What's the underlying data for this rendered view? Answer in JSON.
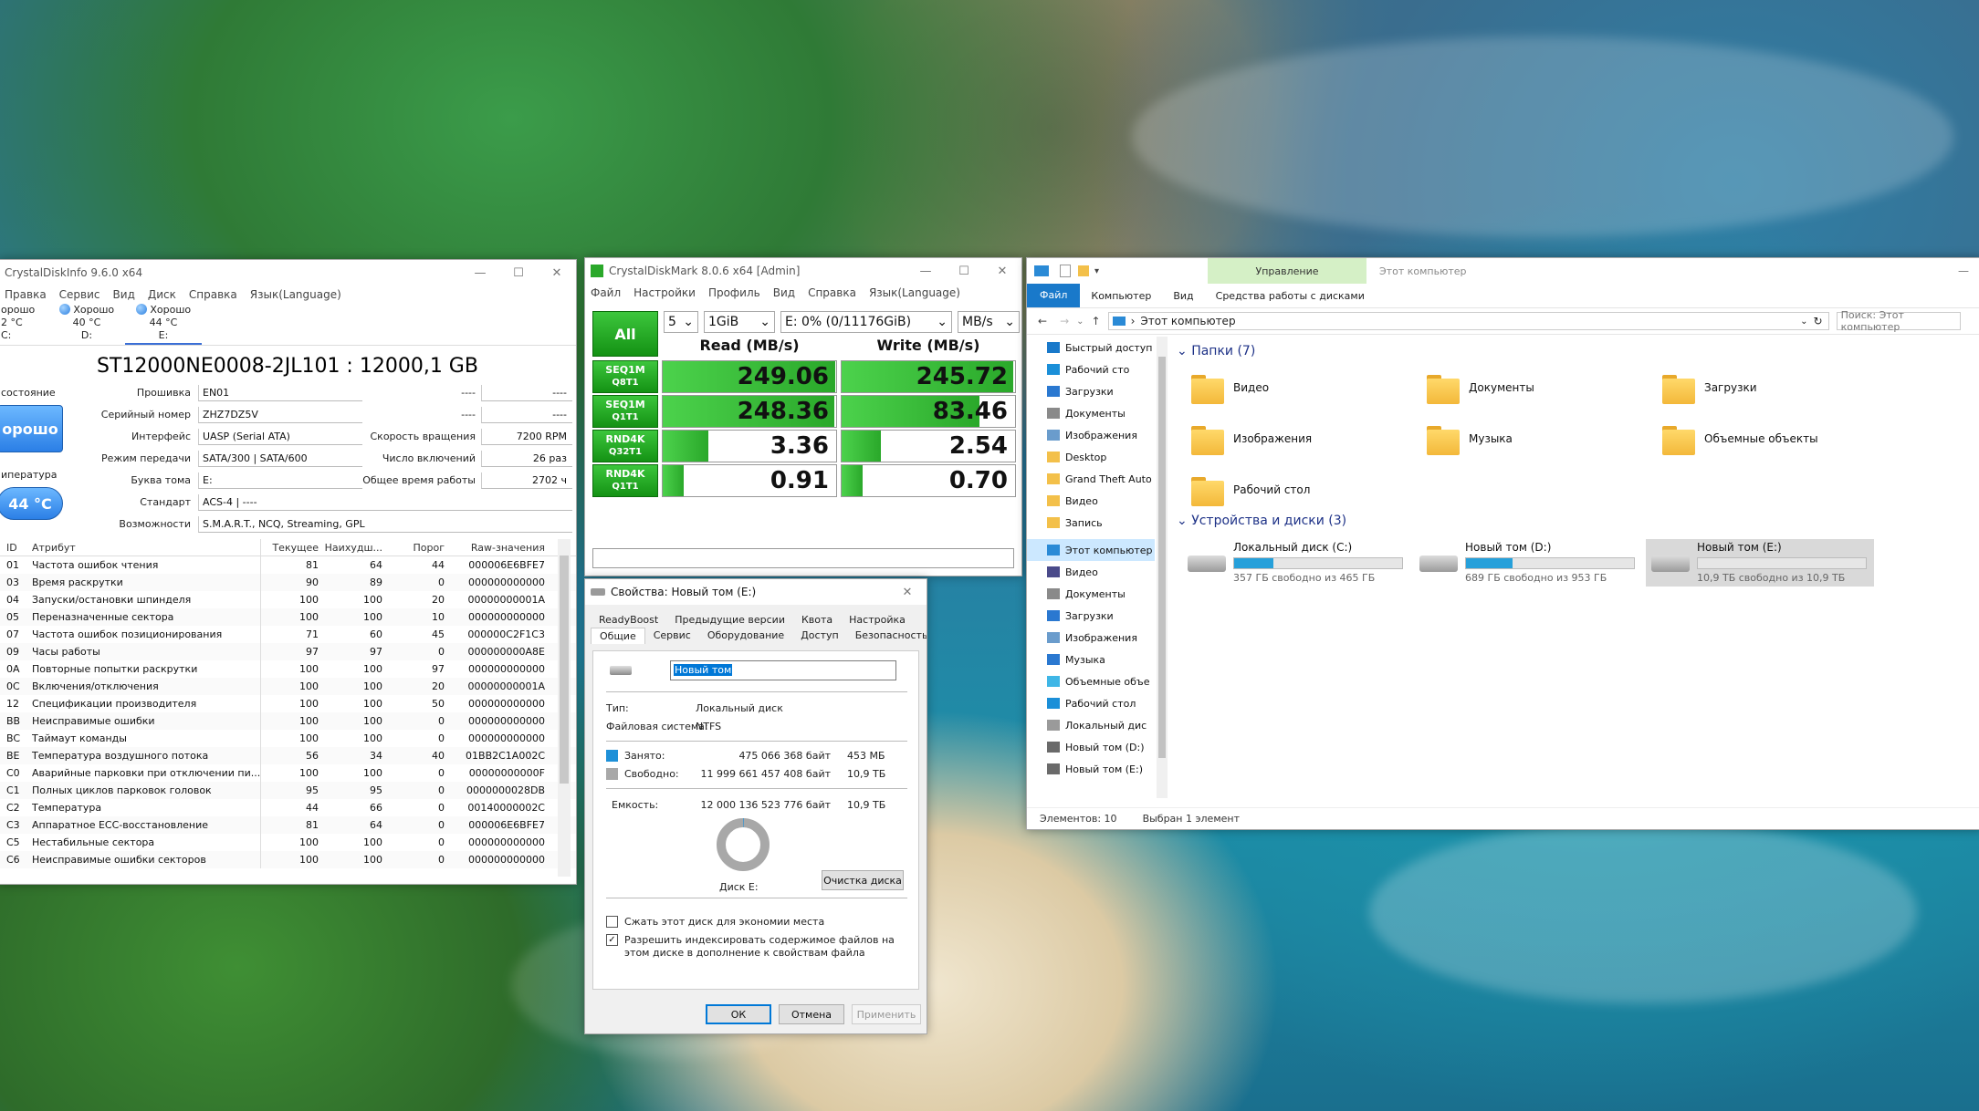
{
  "cdi": {
    "title": "CrystalDiskInfo 9.6.0 x64",
    "menu": [
      "Правка",
      "Сервис",
      "Вид",
      "Диск",
      "Справка",
      "Язык(Language)"
    ],
    "health_tabs": [
      {
        "status": "орошо",
        "temp": "2 °C",
        "drive": "C:"
      },
      {
        "status": "Хорошо",
        "temp": "40 °C",
        "drive": "D:"
      },
      {
        "status": "Хорошо",
        "temp": "44 °C",
        "drive": "E:"
      }
    ],
    "model": "ST12000NE0008-2JL101 : 12000,1 GB",
    "state_label": "состояние",
    "state_value": "орошо",
    "temp_label": "ипература",
    "temp_value": "44 °C",
    "fields": {
      "firmware_label": "Прошивка",
      "firmware": "EN01",
      "serial_label": "Серийный номер",
      "serial": "ZHZ7DZ5V",
      "interface_label": "Интерфейс",
      "interface": "UASP (Serial ATA)",
      "transfer_label": "Режим передачи",
      "transfer": "SATA/300 | SATA/600",
      "letter_label": "Буква тома",
      "letter": "E:",
      "standard_label": "Стандарт",
      "standard": "ACS-4 | ----",
      "features_label": "Возможности",
      "features": "S.M.A.R.T., NCQ, Streaming, GPL",
      "dash1": "----",
      "dash1v": "----",
      "dash2": "----",
      "dash2v": "----",
      "rotation_label": "Скорость вращения",
      "rotation": "7200 RPM",
      "power_count_label": "Число включений",
      "power_count": "26 раз",
      "power_hours_label": "Общее время работы",
      "power_hours": "2702 ч"
    },
    "table_headers": {
      "id": "ID",
      "attr": "Атрибут",
      "cur": "Текущее",
      "worst": "Наихудш...",
      "thr": "Порог",
      "raw": "Raw-значения"
    },
    "rows": [
      {
        "id": "01",
        "attr": "Частота ошибок чтения",
        "cur": "81",
        "worst": "64",
        "thr": "44",
        "raw": "000006E6BFE7"
      },
      {
        "id": "03",
        "attr": "Время раскрутки",
        "cur": "90",
        "worst": "89",
        "thr": "0",
        "raw": "000000000000"
      },
      {
        "id": "04",
        "attr": "Запуски/остановки шпинделя",
        "cur": "100",
        "worst": "100",
        "thr": "20",
        "raw": "00000000001A"
      },
      {
        "id": "05",
        "attr": "Переназначенные сектора",
        "cur": "100",
        "worst": "100",
        "thr": "10",
        "raw": "000000000000"
      },
      {
        "id": "07",
        "attr": "Частота ошибок позиционирования",
        "cur": "71",
        "worst": "60",
        "thr": "45",
        "raw": "000000C2F1C3"
      },
      {
        "id": "09",
        "attr": "Часы работы",
        "cur": "97",
        "worst": "97",
        "thr": "0",
        "raw": "000000000A8E"
      },
      {
        "id": "0A",
        "attr": "Повторные попытки раскрутки",
        "cur": "100",
        "worst": "100",
        "thr": "97",
        "raw": "000000000000"
      },
      {
        "id": "0C",
        "attr": "Включения/отключения",
        "cur": "100",
        "worst": "100",
        "thr": "20",
        "raw": "00000000001A"
      },
      {
        "id": "12",
        "attr": "Спецификации производителя",
        "cur": "100",
        "worst": "100",
        "thr": "50",
        "raw": "000000000000"
      },
      {
        "id": "BB",
        "attr": "Неисправимые ошибки",
        "cur": "100",
        "worst": "100",
        "thr": "0",
        "raw": "000000000000"
      },
      {
        "id": "BC",
        "attr": "Таймаут команды",
        "cur": "100",
        "worst": "100",
        "thr": "0",
        "raw": "000000000000"
      },
      {
        "id": "BE",
        "attr": "Температура воздушного потока",
        "cur": "56",
        "worst": "34",
        "thr": "40",
        "raw": "01BB2C1A002C"
      },
      {
        "id": "C0",
        "attr": "Аварийные парковки при отключении пи...",
        "cur": "100",
        "worst": "100",
        "thr": "0",
        "raw": "00000000000F"
      },
      {
        "id": "C1",
        "attr": "Полных циклов парковок головок",
        "cur": "95",
        "worst": "95",
        "thr": "0",
        "raw": "0000000028DB"
      },
      {
        "id": "C2",
        "attr": "Температура",
        "cur": "44",
        "worst": "66",
        "thr": "0",
        "raw": "00140000002C"
      },
      {
        "id": "C3",
        "attr": "Аппаратное ECC-восстановление",
        "cur": "81",
        "worst": "64",
        "thr": "0",
        "raw": "000006E6BFE7"
      },
      {
        "id": "C5",
        "attr": "Нестабильные сектора",
        "cur": "100",
        "worst": "100",
        "thr": "0",
        "raw": "000000000000"
      },
      {
        "id": "C6",
        "attr": "Неисправимые ошибки секторов",
        "cur": "100",
        "worst": "100",
        "thr": "0",
        "raw": "000000000000"
      }
    ]
  },
  "cdm": {
    "title": "CrystalDiskMark 8.0.6 x64 [Admin]",
    "menu": [
      "Файл",
      "Настройки",
      "Профиль",
      "Вид",
      "Справка",
      "Язык(Language)"
    ],
    "all_label": "All",
    "count": "5",
    "size": "1GiB",
    "target": "E: 0% (0/11176GiB)",
    "unit": "MB/s",
    "read_header": "Read (MB/s)",
    "write_header": "Write (MB/s)",
    "max_scale": 260,
    "tests": [
      {
        "line1": "SEQ1M",
        "line2": "Q8T1",
        "read": "249.06",
        "write": "245.72"
      },
      {
        "line1": "SEQ1M",
        "line2": "Q1T1",
        "read": "248.36",
        "write": "83.46"
      },
      {
        "line1": "RND4K",
        "line2": "Q32T1",
        "read": "3.36",
        "write": "2.54"
      },
      {
        "line1": "RND4K",
        "line2": "Q1T1",
        "read": "0.91",
        "write": "0.70"
      }
    ]
  },
  "props": {
    "title": "Свойства: Новый том (E:)",
    "tabs_row1": [
      "ReadyBoost",
      "Предыдущие версии",
      "Квота",
      "Настройка"
    ],
    "tabs_row2": [
      "Общие",
      "Сервис",
      "Оборудование",
      "Доступ",
      "Безопасность"
    ],
    "volume_name": "Новый том",
    "type_label": "Тип:",
    "type_value": "Локальный диск",
    "fs_label": "Файловая система:",
    "fs_value": "NTFS",
    "used_label": "Занято:",
    "used_bytes": "475 066 368 байт",
    "used_short": "453 МБ",
    "free_label": "Свободно:",
    "free_bytes": "11 999 661 457 408 байт",
    "free_short": "10,9 ТБ",
    "cap_label": "Емкость:",
    "cap_bytes": "12 000 136 523 776 байт",
    "cap_short": "10,9 ТБ",
    "used_fraction": 3.96e-05,
    "disk_label": "Диск E:",
    "cleanup_button": "Очистка диска",
    "compress_label": "Сжать этот диск для экономии места",
    "index_label": "Разрешить индексировать содержимое файлов на этом диске в дополнение к свойствам файла",
    "ok_button": "ОК",
    "cancel_button": "Отмена",
    "apply_button": "Применить",
    "colors": {
      "used": "#1e90d8",
      "free": "#a8a8a8"
    }
  },
  "explorer": {
    "title": "Этот компьютер",
    "manage_tab": "Управление",
    "tabs": [
      "Файл",
      "Компьютер",
      "Вид",
      "Средства работы с дисками"
    ],
    "address": "Этот компьютер",
    "search_placeholder": "Поиск: Этот компьютер",
    "nav": [
      {
        "label": "Быстрый доступ",
        "icon": "star-icon",
        "color": "#1979ca"
      },
      {
        "label": "Рабочий сто",
        "icon": "desktop-icon",
        "color": "#1b8fd8"
      },
      {
        "label": "Загрузки",
        "icon": "download-icon",
        "color": "#2a78d0"
      },
      {
        "label": "Документы",
        "icon": "documents-icon",
        "color": "#8a8a8a"
      },
      {
        "label": "Изображения",
        "icon": "pictures-icon",
        "color": "#6a9ccc"
      },
      {
        "label": "Desktop",
        "icon": "folder-icon",
        "color": "#f3c04a"
      },
      {
        "label": "Grand Theft Auto",
        "icon": "folder-icon",
        "color": "#f3c04a"
      },
      {
        "label": "Видео",
        "icon": "folder-icon",
        "color": "#f3c04a"
      },
      {
        "label": "Запись",
        "icon": "folder-icon",
        "color": "#f3c04a"
      },
      {
        "label": "Этот компьютер",
        "icon": "computer-icon",
        "color": "#2a8ad6"
      },
      {
        "label": "Видео",
        "icon": "video-icon",
        "color": "#4a4a8a"
      },
      {
        "label": "Документы",
        "icon": "documents-icon",
        "color": "#8a8a8a"
      },
      {
        "label": "Загрузки",
        "icon": "download-icon",
        "color": "#2a78d0"
      },
      {
        "label": "Изображения",
        "icon": "pictures-icon",
        "color": "#6a9ccc"
      },
      {
        "label": "Музыка",
        "icon": "music-icon",
        "color": "#2a78d0"
      },
      {
        "label": "Объемные объе",
        "icon": "3d-icon",
        "color": "#3fb6e6"
      },
      {
        "label": "Рабочий стол",
        "icon": "desktop-icon",
        "color": "#1b8fd8"
      },
      {
        "label": "Локальный дис",
        "icon": "drive-icon",
        "color": "#9a9a9a"
      },
      {
        "label": "Новый том (D:)",
        "icon": "drive-icon",
        "color": "#6a6a6a"
      },
      {
        "label": "Новый том (E:)",
        "icon": "drive-icon",
        "color": "#6a6a6a"
      }
    ],
    "folders_header": "Папки (7)",
    "folders": [
      "Видео",
      "Документы",
      "Загрузки",
      "Изображения",
      "Музыка",
      "Объемные объекты",
      "Рабочий стол"
    ],
    "devices_header": "Устройства и диски (3)",
    "drives": [
      {
        "name": "Локальный диск (C:)",
        "free": "357 ГБ свободно из 465 ГБ",
        "used_fraction": 0.232
      },
      {
        "name": "Новый том (D:)",
        "free": "689 ГБ свободно из 953 ГБ",
        "used_fraction": 0.277
      },
      {
        "name": "Новый том (E:)",
        "free": "10,9 ТБ свободно из 10,9 ТБ",
        "used_fraction": 0.0
      }
    ],
    "status_items": "Элементов: 10",
    "status_selected": "Выбран 1 элемент"
  }
}
